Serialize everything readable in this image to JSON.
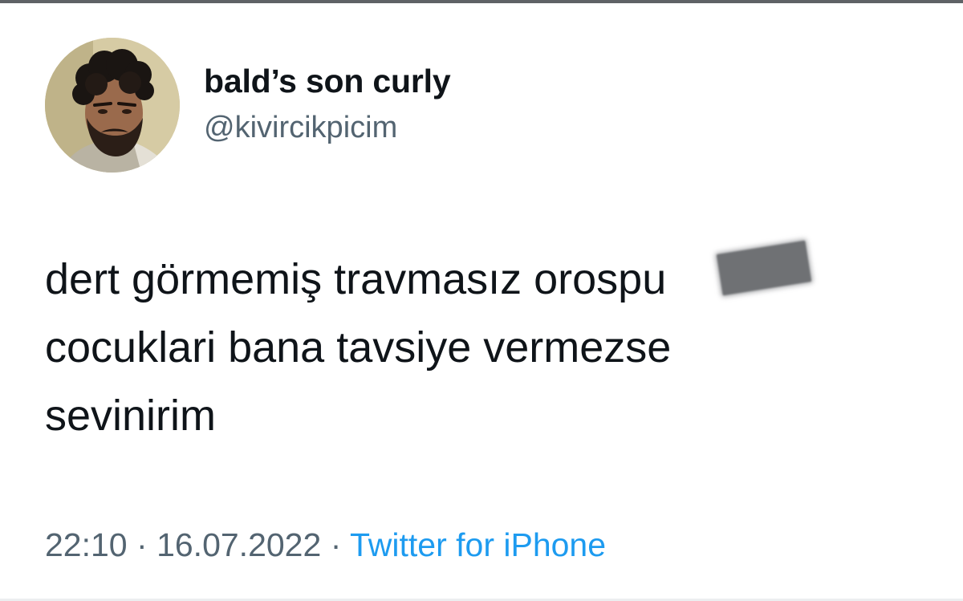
{
  "tweet": {
    "author": {
      "display_name": "bald’s son curly",
      "handle": "@kivircikpicim",
      "avatar_icon": "profile-photo"
    },
    "text_lines": [
      "dert görmemiş travmasız orospu",
      "cocuklari bana tavsiye vermezse",
      "sevinirim"
    ],
    "time": "22:10",
    "date": "16.07.2022",
    "separator": "·",
    "source": "Twitter for iPhone"
  },
  "colors": {
    "text_primary": "#0f1419",
    "text_secondary": "#536471",
    "link": "#1d9bf0",
    "censor": "#6f7174"
  }
}
